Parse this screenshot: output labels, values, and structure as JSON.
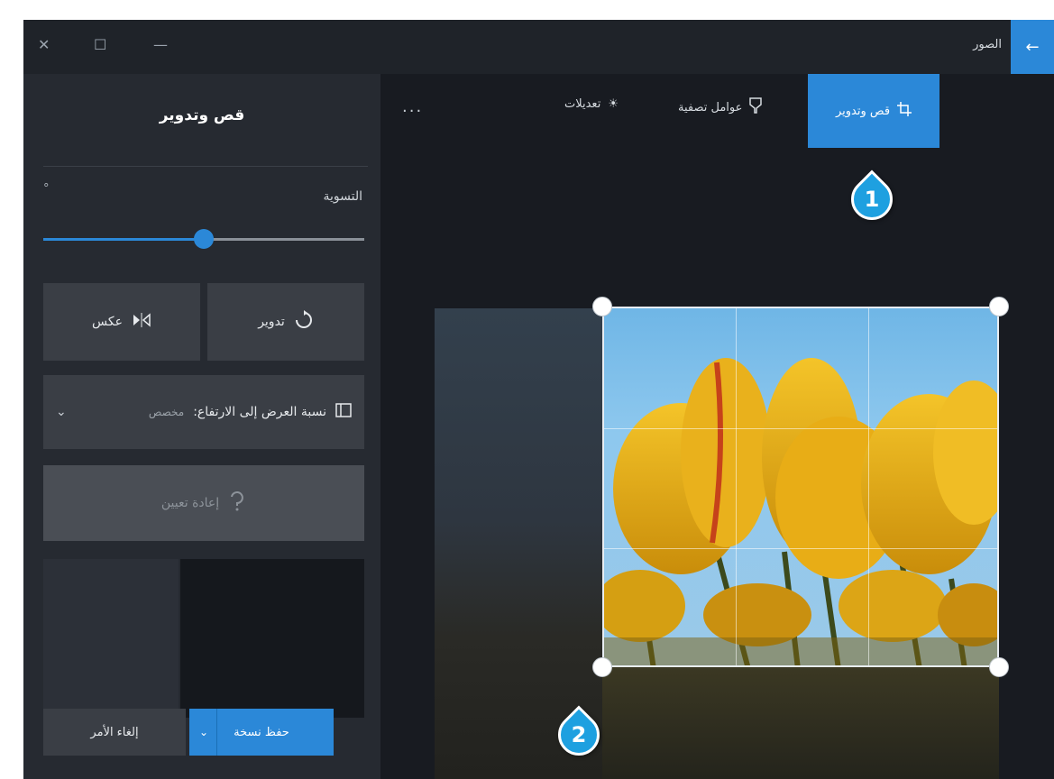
{
  "window": {
    "app_title": "الصور",
    "close_icon": "close-icon",
    "maximize_icon": "maximize-icon",
    "minimize_icon": "minimize-icon",
    "back_icon": "back-arrow-icon",
    "accent_color": "#2b88d8"
  },
  "toolbar": {
    "tabs": [
      {
        "label": "قص وتدوير",
        "icon": "crop-rotate-icon",
        "active": true
      },
      {
        "label": "عوامل تصفية",
        "icon": "filter-icon",
        "active": false
      },
      {
        "label": "تعديلات",
        "icon": "brightness-icon",
        "active": false
      }
    ],
    "more_label": "..."
  },
  "panel": {
    "title": "قص وتدوير",
    "straighten_label": "التسوية",
    "straighten_value": "°",
    "straighten_fraction": 0.5,
    "rotate_label": "تدوير",
    "flip_label": "عكس",
    "aspect_label": "نسبة العرض إلى الارتفاع:",
    "aspect_value": "مخصص",
    "reset_label": "إعادة تعيين",
    "save_label": "حفظ نسخة",
    "cancel_label": "إلغاء الأمر"
  },
  "callouts": [
    "1",
    "2"
  ]
}
